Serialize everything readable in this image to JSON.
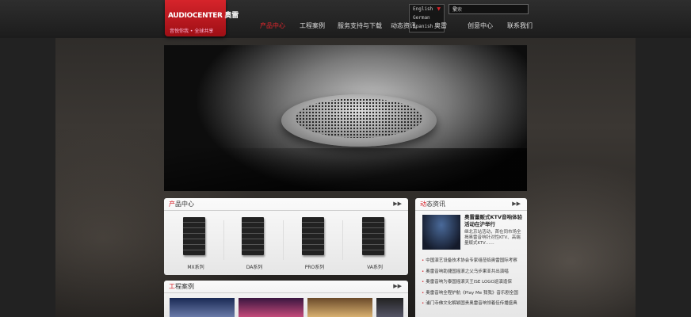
{
  "header": {
    "logo_text": "AUDIOCENTER 奥雷",
    "slogan": "音悦你我 • 全球共享",
    "languages": [
      "English",
      "German",
      "Spanish"
    ],
    "search_placeholder": "搜索"
  },
  "nav": [
    {
      "label": "产品中心",
      "active": true
    },
    {
      "label": "工程案例"
    },
    {
      "label": "服务支持与下载"
    },
    {
      "label": "动态资讯"
    },
    {
      "label": "奥雷"
    },
    {
      "label": "创意中心"
    },
    {
      "label": "联系我们"
    }
  ],
  "products_panel": {
    "title_first": "产",
    "title_rest": "品中心",
    "more": "▶▶",
    "items": [
      {
        "label": "MX系列"
      },
      {
        "label": "DA系列"
      },
      {
        "label": "PRO系列"
      },
      {
        "label": "VA系列"
      }
    ]
  },
  "cases_panel": {
    "title_first": "工",
    "title_rest": "程案例",
    "more": "▶▶"
  },
  "news_panel": {
    "title_first": "动",
    "title_rest": "态资讯",
    "more": "▶▶",
    "featured_title": "奥雷量贩式KTV音响体验活动在沪举行",
    "featured_desc": "继北京站活动，首在同市场全揭奥雷音响针对性KTV、高端量贩式KTV……",
    "items": [
      "中国演艺设备技术协会专家组莅临奥雷国际考察",
      "奥雷音响助捷国摇滚之父乌步果亚共出演唱",
      "奥雷音响为泰国摇滚天王ISE LOGO巡演造保",
      "奥雷音响全程护航《Play Me 我我》音乐剧全国",
      "浦门寺佛文化解颖固贵奥雷音响领着佳传播盛典"
    ]
  }
}
